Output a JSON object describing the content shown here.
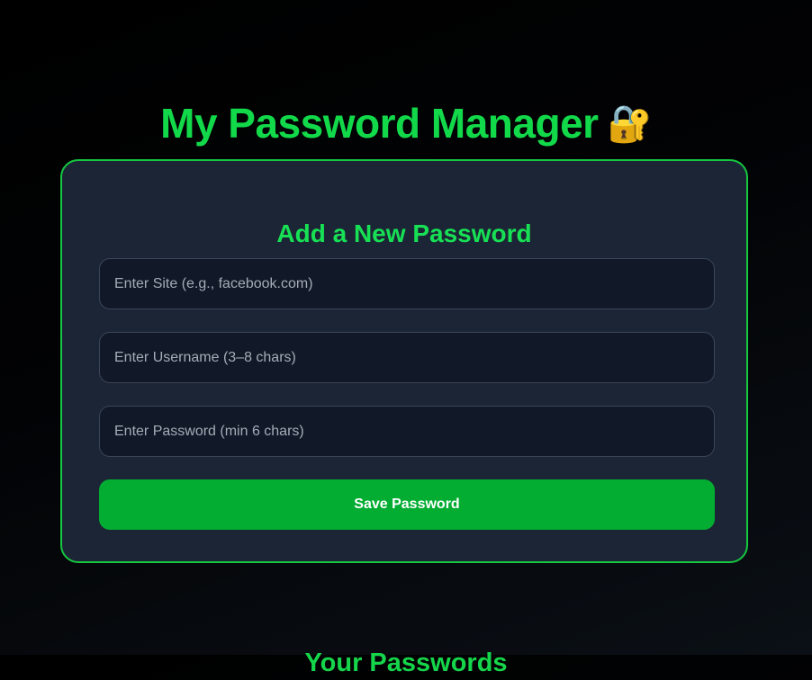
{
  "header": {
    "title": "My Password Manager",
    "title_icon": "🔐"
  },
  "form": {
    "title": "Add a New Password",
    "site_placeholder": "Enter Site (e.g., facebook.com)",
    "site_value": "",
    "username_placeholder": "Enter Username (3–8 chars)",
    "username_value": "",
    "password_placeholder": "Enter Password (min 6 chars)",
    "password_value": "",
    "save_label": "Save Password"
  },
  "list": {
    "title": "Your Passwords"
  },
  "colors": {
    "accent": "#12d94a",
    "button": "#03ad32",
    "card": "#1c2535",
    "card_border": "#16c740",
    "input_bg": "#111827"
  },
  "icons": {
    "title_icon": "lock-with-key-icon"
  }
}
